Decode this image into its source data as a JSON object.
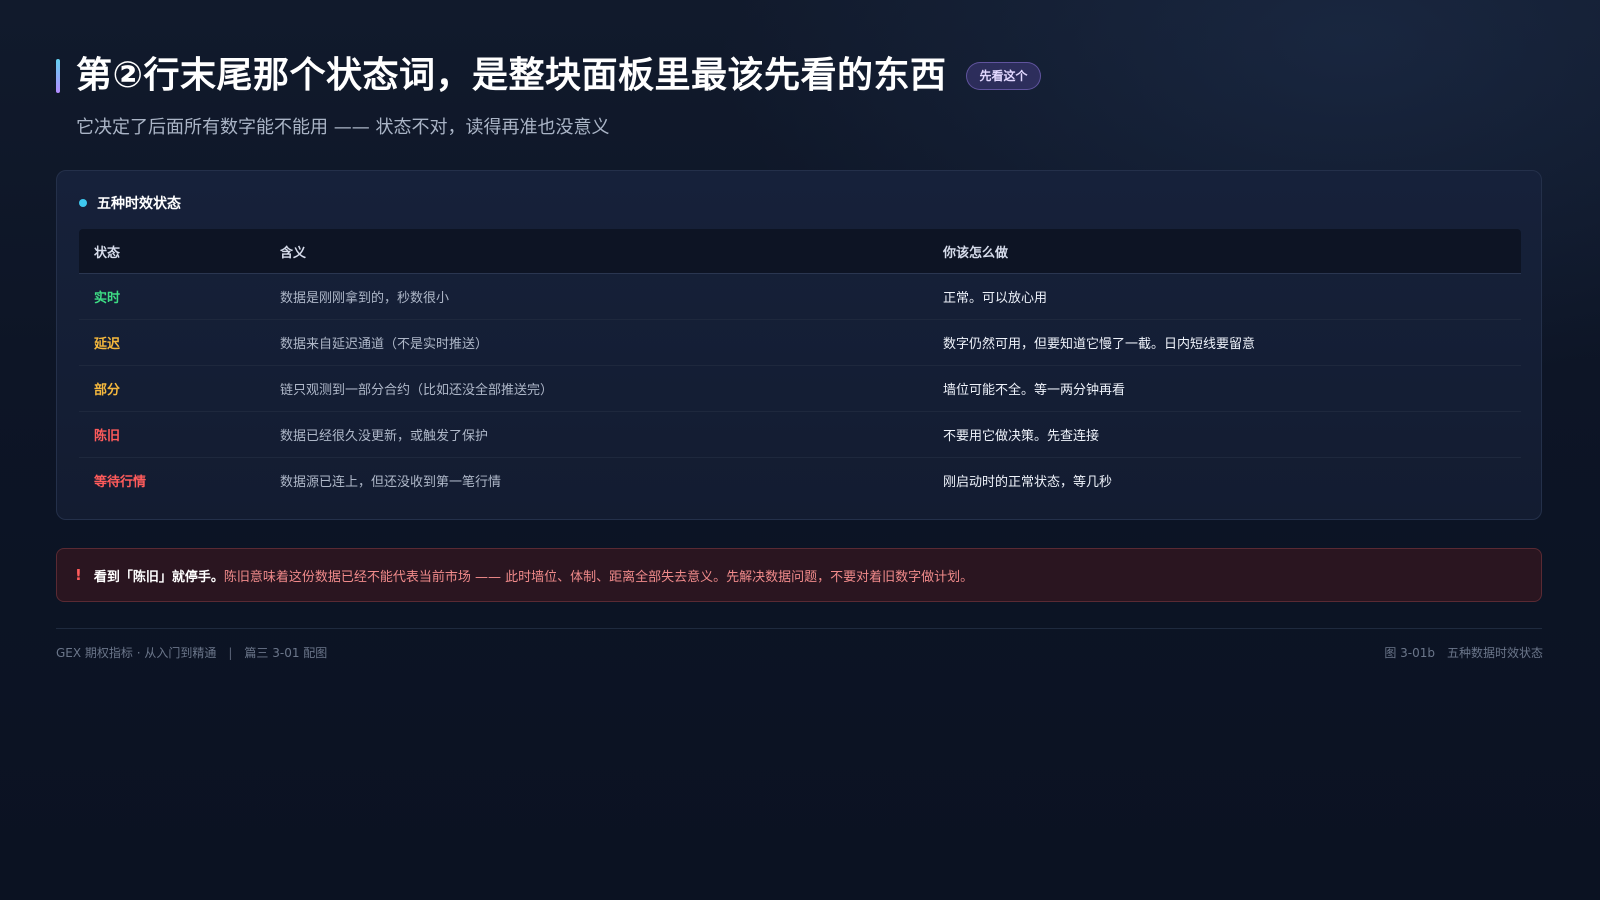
{
  "header": {
    "title": "第②行末尾那个状态词，是整块面板里最该先看的东西",
    "badge": "先看这个",
    "subtitle": "它决定了后面所有数字能不能用 —— 状态不对，读得再准也没意义"
  },
  "card": {
    "title": "五种时效状态",
    "columns": [
      "状态",
      "含义",
      "你该怎么做"
    ],
    "rows": [
      {
        "status": "实时",
        "color": "#3ddc84",
        "meaning": "数据是刚刚拿到的，秒数很小",
        "action": "正常。可以放心用"
      },
      {
        "status": "延迟",
        "color": "#f5b83d",
        "meaning": "数据来自延迟通道（不是实时推送）",
        "action": "数字仍然可用，但要知道它慢了一截。日内短线要留意"
      },
      {
        "status": "部分",
        "color": "#f5b83d",
        "meaning": "链只观测到一部分合约（比如还没全部推送完）",
        "action": "墙位可能不全。等一两分钟再看"
      },
      {
        "status": "陈旧",
        "color": "#ff5b5b",
        "meaning": "数据已经很久没更新，或触发了保护",
        "action": "不要用它做决策。先查连接"
      },
      {
        "status": "等待行情",
        "color": "#ff5b5b",
        "meaning": "数据源已连上，但还没收到第一笔行情",
        "action": "刚启动时的正常状态，等几秒"
      }
    ]
  },
  "alert": {
    "icon": "!",
    "strong": "看到「陈旧」就停手。",
    "text": "陈旧意味着这份数据已经不能代表当前市场 —— 此时墙位、体制、距离全部失去意义。先解决数据问题，不要对着旧数字做计划。"
  },
  "footer": {
    "left_series": "GEX 期权指标 · 从入门到精通",
    "separator": "|",
    "left_chapter": "篇三 3-01 配图",
    "right_figure": "图 3-01b",
    "right_caption": "五种数据时效状态"
  },
  "colors": {
    "accent_top": "#62d0f0",
    "accent_bottom": "#b48cff",
    "realtime": "#3ddc84",
    "warning": "#f5b83d",
    "danger": "#ff5b5b"
  }
}
